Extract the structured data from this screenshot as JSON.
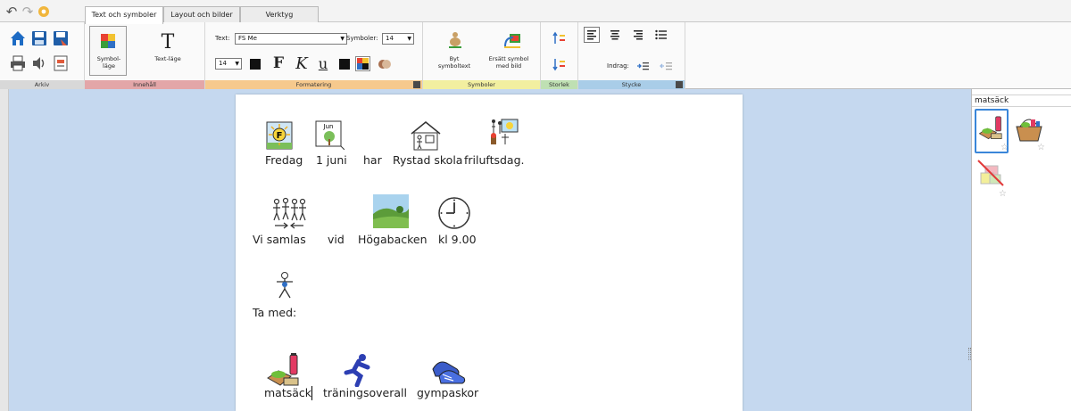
{
  "tabs": [
    {
      "label": "Text och symboler",
      "active": true
    },
    {
      "label": "Layout och bilder",
      "active": false
    },
    {
      "label": "Verktyg",
      "active": false
    }
  ],
  "ribbon": {
    "arkiv": {
      "label": "Arkiv"
    },
    "innehall": {
      "label": "Innehåll",
      "symbol_mode": "Symbol-läge",
      "text_mode": "Text-läge"
    },
    "formatering": {
      "label": "Formatering",
      "text_label": "Text:",
      "font_value": "FS Me",
      "symbols_label": "Symboler:",
      "symbols_size": "14",
      "font_size": "14",
      "bold": "F",
      "italic": "K",
      "underline": "U"
    },
    "symboler": {
      "label": "Symboler",
      "swap_label": "Byt symboltext",
      "replace_label": "Ersätt symbol med bild"
    },
    "storlek": {
      "label": "Storlek"
    },
    "stycke": {
      "label": "Stycke",
      "indent_label": "Indrag:"
    }
  },
  "document": {
    "line1": [
      "Fredag",
      "1 juni",
      "har",
      "Rystad skola",
      "friluftsdag."
    ],
    "line2": [
      "Vi samlas",
      "vid",
      "Högabacken",
      "kl 9.00"
    ],
    "line3": [
      "Ta med:"
    ],
    "line4": [
      "matsäck",
      "träningsoverall",
      "gympaskor"
    ],
    "calendar_text": "Jun",
    "sun_letter": "F"
  },
  "panel": {
    "title": "matsäck",
    "star": "☆"
  },
  "colors": {
    "accent": "#3a86d9",
    "workarea": "#c5d8ef",
    "home": "#1d6bc4"
  }
}
